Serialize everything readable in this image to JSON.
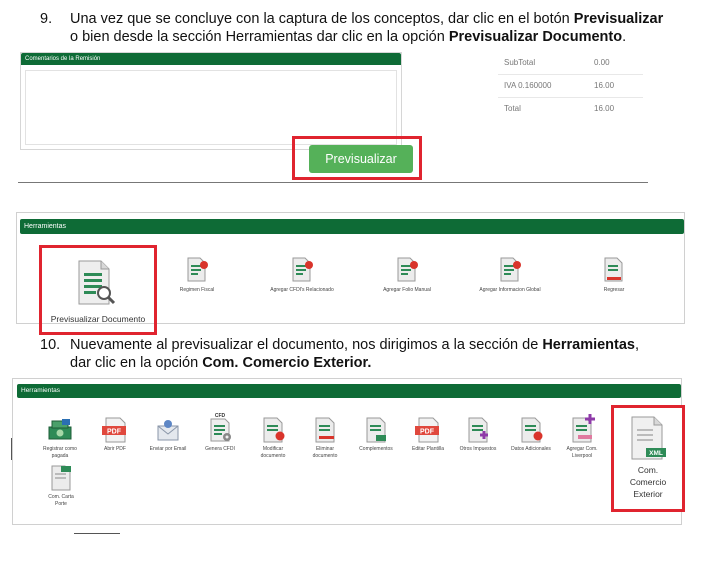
{
  "step9": {
    "number": "9.",
    "line1_a": "Una vez que se concluye con la captura de los conceptos, dar clic en el botón ",
    "line1_b": "Previsualizar",
    "line2_a": "o bien desde la sección Herramientas dar clic en la opción ",
    "line2_b": "Previsualizar Documento",
    "line2_c": "."
  },
  "remision": {
    "comments_title": "Comentarios de la Remisión",
    "totals": [
      {
        "label": "SubTotal",
        "value": "0.00"
      },
      {
        "label": "IVA 0.160000",
        "value": "16.00"
      },
      {
        "label": "Total",
        "value": "16.00"
      }
    ],
    "preview_button": "Previsualizar"
  },
  "tools1": {
    "title": "Herramientas",
    "highlight_label": "Previsualizar Documento",
    "items": [
      "Regimen Fiscal",
      "Agregar CFDI's Relacionado",
      "Agregar Folio Manual",
      "Agregar Informacion Global",
      "Regresar"
    ]
  },
  "step10": {
    "number": "10.",
    "line1_a": "Nuevamente al previsualizar el documento, nos dirigimos a la sección de ",
    "line1_b": "Herramientas",
    "line1_c": ",",
    "line2_a": "dar clic en la opción ",
    "line2_b": "Com. Comercio Exterior."
  },
  "tools2": {
    "title": "Herramientas",
    "items": [
      {
        "l1": "Registrar como",
        "l2": "pagada"
      },
      {
        "l1": "Abrir PDF",
        "l2": ""
      },
      {
        "l1": "Enviar por Email",
        "l2": ""
      },
      {
        "l1": "Genera CFDI",
        "l2": ""
      },
      {
        "l1": "Modificar",
        "l2": "documento"
      },
      {
        "l1": "Eliminar",
        "l2": "documento"
      },
      {
        "l1": "Complementos",
        "l2": ""
      },
      {
        "l1": "Editar Plantilla",
        "l2": ""
      },
      {
        "l1": "Otros Impuestos",
        "l2": ""
      },
      {
        "l1": "Datos Adicionales",
        "l2": ""
      },
      {
        "l1": "Agregar Com.",
        "l2": "Liverpool"
      }
    ],
    "carta_porte": {
      "l1": "Com. Carta",
      "l2": "Porte"
    },
    "highlight": {
      "l1": "Com.",
      "l2": "Comercio",
      "l3": "Exterior"
    },
    "icon_texts": {
      "pdf": "PDF",
      "cfd": "CFD",
      "xml": "XML"
    }
  },
  "colors": {
    "header_green": "#0e6b36",
    "button_green": "#55b159",
    "highlight_red": "#e0242f"
  }
}
